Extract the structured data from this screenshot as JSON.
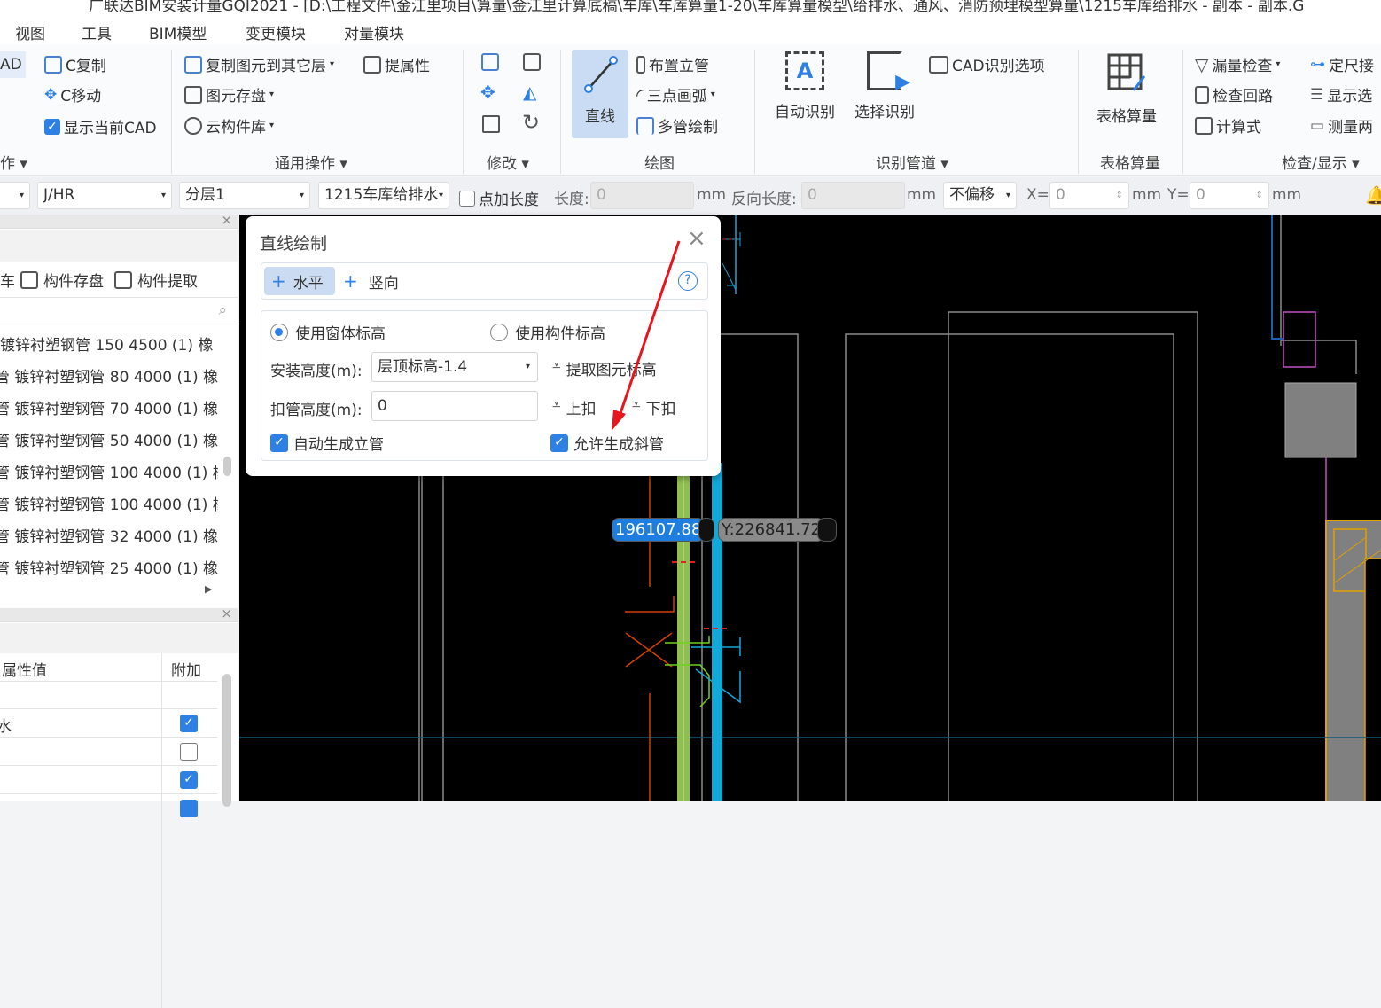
{
  "title": "广联达BIM安装计量GQI2021 - [D:\\工程文件\\金江里项目\\算量\\金江里计算底稿\\车库\\车库算量1-20\\车库算量模型\\给排水、通风、消防预埋模型算量\\1215车库给排水 - 副本 - 副本.G",
  "menu": [
    "视图",
    "工具",
    "BIM模型",
    "变更模块",
    "对量模块"
  ],
  "ribbon": {
    "cad_partial": "AD",
    "copy": "C复制",
    "move": "C移动",
    "show_cad": "显示当前CAD",
    "group0": "作",
    "copy_to_layer": "复制图元到其它层",
    "pick_attr": "提属性",
    "save_elem": "图元存盘",
    "cloud_lib": "云构件库",
    "group_general": "通用操作",
    "group_modify": "修改",
    "line": "直线",
    "riser": "布置立管",
    "arc": "三点画弧",
    "multi": "多管绘制",
    "group_draw": "绘图",
    "auto_recog": "自动识别",
    "select_recog": "选择识别",
    "cad_options": "CAD识别选项",
    "group_recog": "识别管道",
    "table_calc": "表格算量",
    "group_table": "表格算量",
    "missing_check": "漏量检查",
    "fixed_len": "定尺接",
    "check_loop": "检查回路",
    "show_sel": "显示选",
    "formula": "计算式",
    "measure": "测量两",
    "group_check": "检查/显示"
  },
  "toolbar": {
    "type": "J/HR",
    "layer": "分层1",
    "component": "1215车库给排水",
    "add_len": "点加长度",
    "len_label": "长度:",
    "len_value": "0",
    "mm": "mm",
    "rev_len_label": "反向长度:",
    "rev_len_value": "0",
    "offset": "不偏移",
    "x_label": "X=",
    "x_value": "0",
    "y_label": "Y=",
    "y_value": "0"
  },
  "left_panel": {
    "lib_partial": "车",
    "save_comp": "构件存盘",
    "extract_comp": "构件提取",
    "items": [
      "镀锌衬塑钢管 150 4500 (1) 橡",
      "管 镀锌衬塑钢管 80 4000 (1) 橡",
      "管 镀锌衬塑钢管 70 4000 (1) 橡",
      "管 镀锌衬塑钢管 50 4000 (1) 橡",
      "管 镀锌衬塑钢管 100 4000 (1) 橡",
      "管 镀锌衬塑钢管 100 4000 (1) 橡",
      "管 镀锌衬塑钢管 32 4000 (1) 橡",
      "管 镀锌衬塑钢管 25 4000 (1) 橡"
    ],
    "prop_header": "属性值",
    "extra_header": "附加",
    "rows": [
      {
        "value": "",
        "checked": null
      },
      {
        "value": "水",
        "checked": true
      },
      {
        "value": "",
        "checked": false
      },
      {
        "value": "",
        "checked": true
      }
    ]
  },
  "dialog": {
    "title": "直线绘制",
    "horizontal": "水平",
    "vertical": "竖向",
    "use_window_elev": "使用窗体标高",
    "use_comp_elev": "使用构件标高",
    "install_height_label": "安装高度(m):",
    "install_height": "层顶标高-1.4",
    "extract_elev": "提取图元标高",
    "deduct_label": "扣管高度(m):",
    "deduct_value": "0",
    "up": "上扣",
    "down": "下扣",
    "auto_riser": "自动生成立管",
    "allow_slope": "允许生成斜管"
  },
  "coords": {
    "x": "196107.88",
    "y": "Y:226841.72"
  }
}
